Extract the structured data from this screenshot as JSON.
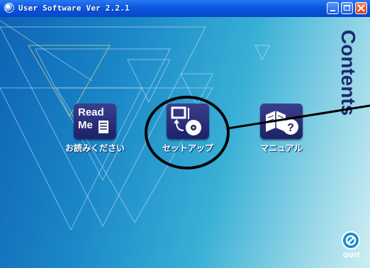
{
  "window": {
    "title": "User Software Ver 2.2.1"
  },
  "side_label": "Contents",
  "menu_items": [
    {
      "label": "お読みください",
      "icon": "readme-icon",
      "icon_text_1": "Read",
      "icon_text_2": "Me"
    },
    {
      "label": "セットアップ",
      "icon": "setup-icon"
    },
    {
      "label": "マニュアル",
      "icon": "manual-icon"
    }
  ],
  "quit": {
    "label": "QUIT"
  },
  "colors": {
    "tile": "#1e2267",
    "annotation": "#000000",
    "label": "#ffffff"
  }
}
